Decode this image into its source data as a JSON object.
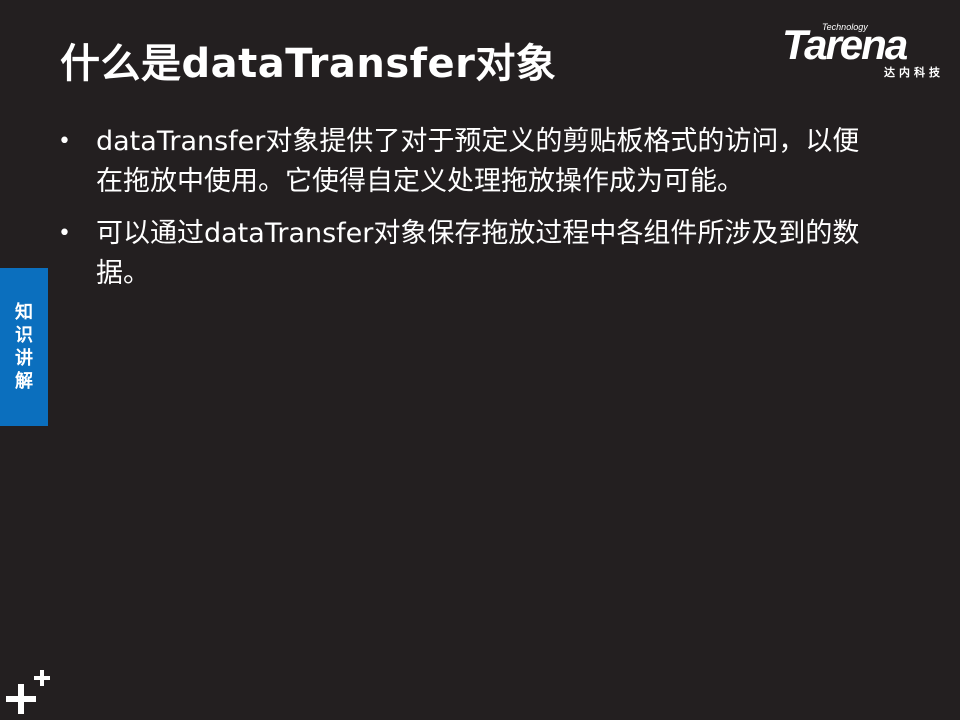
{
  "slide": {
    "title": "什么是dataTransfer对象",
    "side_tab": "知识讲解",
    "bullets": [
      "dataTransfer对象提供了对于预定义的剪贴板格式的访问，以便在拖放中使用。它使得自定义处理拖放操作成为可能。",
      "可以通过dataTransfer对象保存拖放过程中各组件所涉及到的数据。"
    ],
    "bullet_symbol": "•"
  },
  "logo": {
    "wordmark": "Tarena",
    "tagline": "Technology",
    "chinese": "达内科技"
  },
  "icons": {
    "corner": "plus-plus-icon"
  },
  "colors": {
    "background": "#231f20",
    "text": "#ffffff",
    "accent": "#0b6fbe"
  }
}
